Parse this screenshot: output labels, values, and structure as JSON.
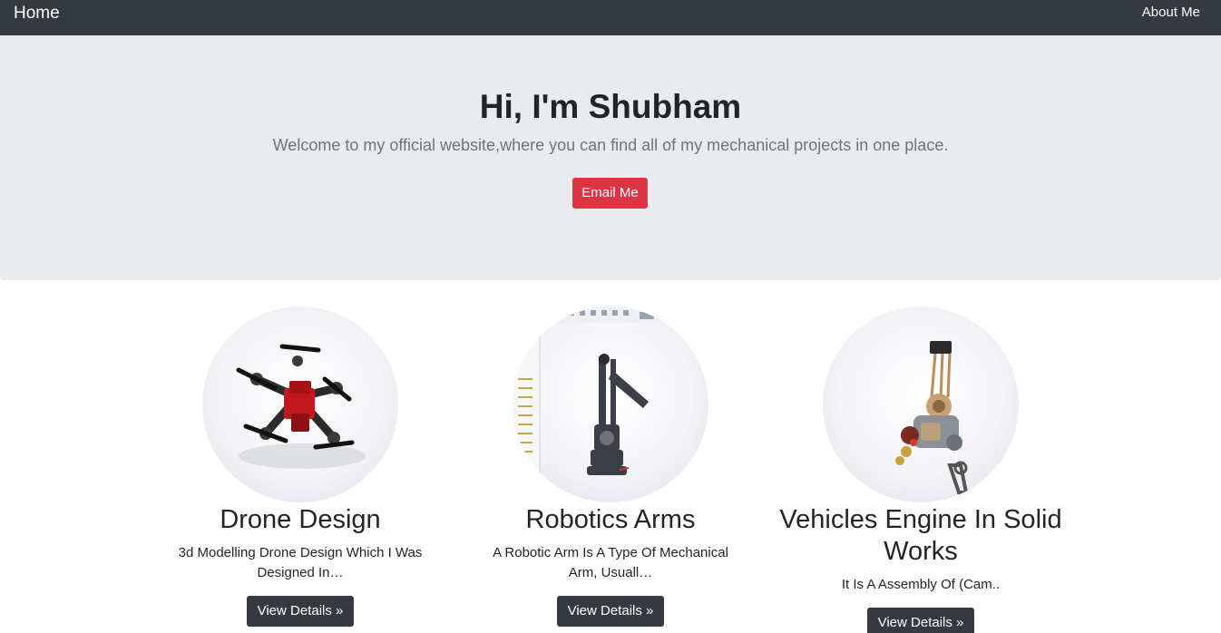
{
  "navbar": {
    "brand": "Home",
    "link": "About Me"
  },
  "hero": {
    "title": "Hi, I'm Shubham",
    "lead": "Welcome to my official website,where you can find all of my mechanical projects in one place.",
    "button": "Email Me"
  },
  "cards": [
    {
      "title": "Drone Design",
      "description": "3d Modelling Drone Design Which I Was Designed In…",
      "button": "View Details »",
      "image": "drone-cad-render"
    },
    {
      "title": "Robotics Arms",
      "description": "A Robotic Arm Is A Type Of Mechanical Arm, Usuall…",
      "button": "View Details »",
      "image": "robotic-arm-cad-render"
    },
    {
      "title": "Vehicles Engine In Solid Works",
      "description": "It Is A Assembly Of (Cam..",
      "button": "View Details »",
      "image": "engine-assembly-cad-render"
    }
  ],
  "colors": {
    "navbar_bg": "#343a40",
    "hero_bg": "#e9ecef",
    "email_button": "#dc3545",
    "details_button": "#343a40"
  }
}
